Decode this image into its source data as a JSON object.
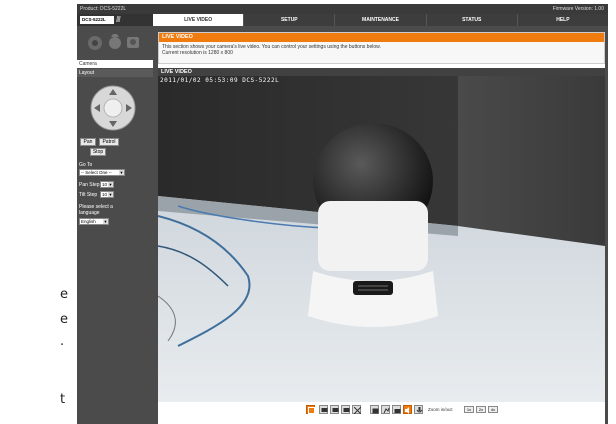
{
  "bleed_text": [
    "e",
    "e",
    ".",
    "t"
  ],
  "topbar": {
    "product": "Product: DCS-5222L",
    "firmware": "Firmware Version: 1.00"
  },
  "logo": {
    "model": "DCS-5222L"
  },
  "nav": [
    "LIVE VIDEO",
    "SETUP",
    "MAINTENANCE",
    "STATUS",
    "HELP"
  ],
  "nav_active": "LIVE VIDEO",
  "sidebar": {
    "camera_label": "Camera",
    "layout_label": "Layout",
    "pan_label": "Pan",
    "patrol_label": "Patrol",
    "stop_label": "Stop",
    "goto_label": "Go To",
    "goto_value": "-- Select One --",
    "pan_step_label": "Pan Step",
    "pan_step_value": "10",
    "tilt_step_label": "Tilt Step",
    "tilt_step_value": "10",
    "language_label": "Please select a language",
    "language_value": "English"
  },
  "info": {
    "title": "LIVE VIDEO",
    "line1": "This section shows your camera's live video. You can control your settings using the buttons below.",
    "line2": "Current resolution is 1280 x 800"
  },
  "live_title": "LIVE VIDEO",
  "osd": "2011/01/02 05:53:09 DCS-5222L",
  "zoom": {
    "label": "Zoom in/out:",
    "options": [
      "1x",
      "2x",
      "4x"
    ]
  },
  "colors": {
    "accent": "#f07b0e",
    "frame": "#4b4b4b"
  }
}
